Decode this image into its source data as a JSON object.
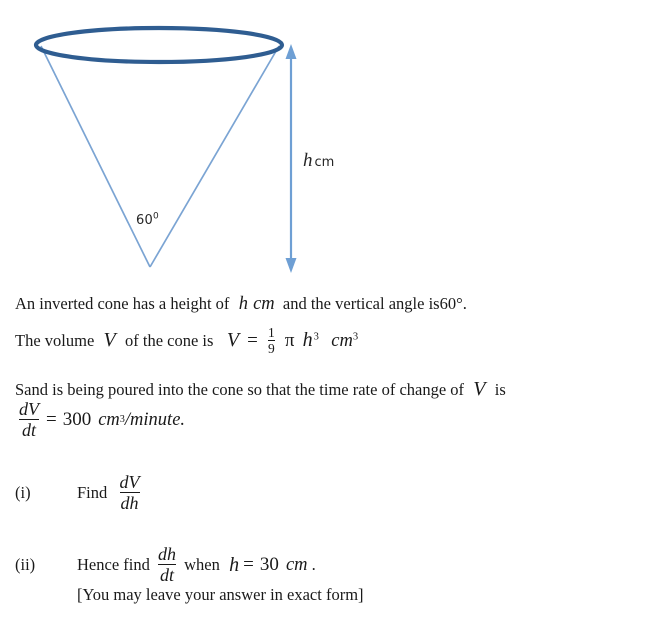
{
  "diagram": {
    "name": "inverted-cone-diagram",
    "colors": {
      "ellipse_stroke": "#2F5D91",
      "cone_side_stroke": "#7BA4D3",
      "arrow_stroke": "#6E9FD4"
    },
    "angle_label": {
      "value": "60",
      "degree_symbol": "0"
    },
    "height_label": {
      "variable": "h",
      "unit": "cm"
    },
    "arrow": {
      "name": "height-dimension-arrow",
      "double_headed": true
    }
  },
  "problem": {
    "intro": {
      "part1": "An inverted cone has a height of",
      "var_h": "h",
      "unit_cm": "cm",
      "part2": "and the vertical angle is60",
      "degree": "°",
      "period": "."
    },
    "volume": {
      "lead": "The volume",
      "var_V": "V",
      "mid": "of the cone is",
      "eq_V": "V",
      "equals": "=",
      "frac_num": "1",
      "frac_den": "9",
      "pi": "π",
      "var_h": "h",
      "exp_h": "3",
      "unit": "cm",
      "unit_exp": "3"
    },
    "sand": {
      "part1": "Sand is being poured into the cone so that the time rate of change of",
      "var_V": "V",
      "part2": "is"
    },
    "rate": {
      "num": "dV",
      "den": "dt",
      "equals": "=",
      "value": "300",
      "unit": "cm",
      "unit_exp": "3",
      "per": "/minute",
      "period": "."
    },
    "parts": [
      {
        "marker": "(i)",
        "verb": "Find",
        "frac_num": "dV",
        "frac_den": "dh"
      },
      {
        "marker": "(ii)",
        "verb": "Hence find",
        "frac_num": "dh",
        "frac_den": "dt",
        "when": "when",
        "var_h": "h",
        "equals": "=",
        "value": "30",
        "unit": "cm",
        "period": "."
      }
    ],
    "note": "[You may leave your answer in exact form]"
  }
}
